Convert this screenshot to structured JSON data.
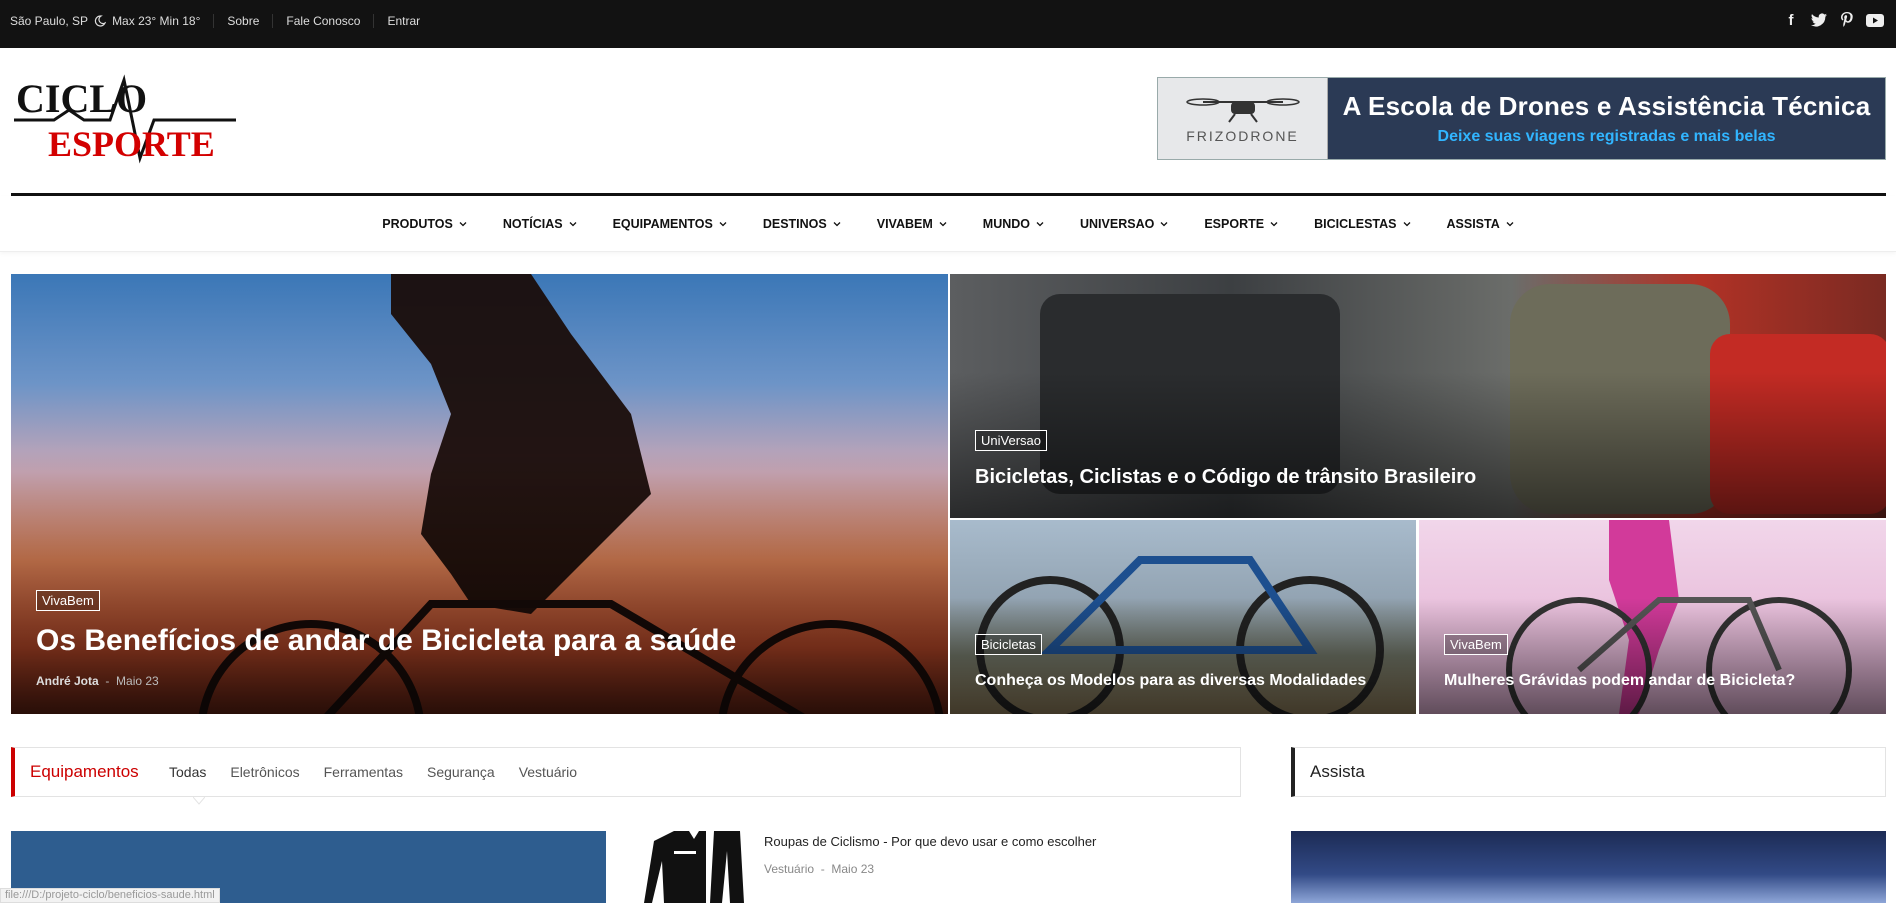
{
  "topbar": {
    "location": "São Paulo, SP",
    "weather": "Max 23° Min 18°",
    "links": [
      "Sobre",
      "Fale Conosco",
      "Entrar"
    ],
    "social": [
      "facebook-icon",
      "twitter-icon",
      "pinterest-icon",
      "youtube-icon"
    ]
  },
  "logo": {
    "line1": "CICLO",
    "line2": "ESPORTE"
  },
  "banner": {
    "brand": "FRIZODRONE",
    "title": "A Escola de Drones e Assistência Técnica",
    "subtitle": "Deixe suas viagens registradas e mais belas"
  },
  "nav": {
    "items": [
      "PRODUTOS",
      "NOTÍCIAS",
      "EQUIPAMENTOS",
      "DESTINOS",
      "VIVABEM",
      "MUNDO",
      "UNIVERSAO",
      "ESPORTE",
      "BICICLESTAS",
      "ASSISTA"
    ]
  },
  "hero": {
    "main": {
      "tag": "VivaBem",
      "title": "Os Benefícios de andar de Bicicleta para a saúde",
      "author": "André Jota",
      "date": "Maio 23"
    },
    "top_right": {
      "tag": "UniVersao",
      "title": "Bicicletas, Ciclistas e o Código de trânsito Brasileiro"
    },
    "bottom_left": {
      "tag": "Bicicletas",
      "title": "Conheça os Modelos para as diversas Modalidades"
    },
    "bottom_right": {
      "tag": "VivaBem",
      "title": "Mulheres Grávidas podem andar de Bicicleta?"
    }
  },
  "section": {
    "title": "Equipamentos",
    "tabs": [
      "Todas",
      "Eletrônicos",
      "Ferramentas",
      "Segurança",
      "Vestuário"
    ],
    "active_tab": "Todas",
    "post": {
      "title": "Roupas de Ciclismo - Por que devo usar e como escolher",
      "category": "Vestuário",
      "date": "Maio 23"
    }
  },
  "sidebar": {
    "title": "Assista"
  },
  "status_url": "file:///D:/projeto-ciclo/beneficios-saude.html",
  "colors": {
    "accent": "#cc0000",
    "topbar_bg": "#121212",
    "banner_bg": "#2b3a55",
    "banner_sub": "#31b5ff"
  }
}
